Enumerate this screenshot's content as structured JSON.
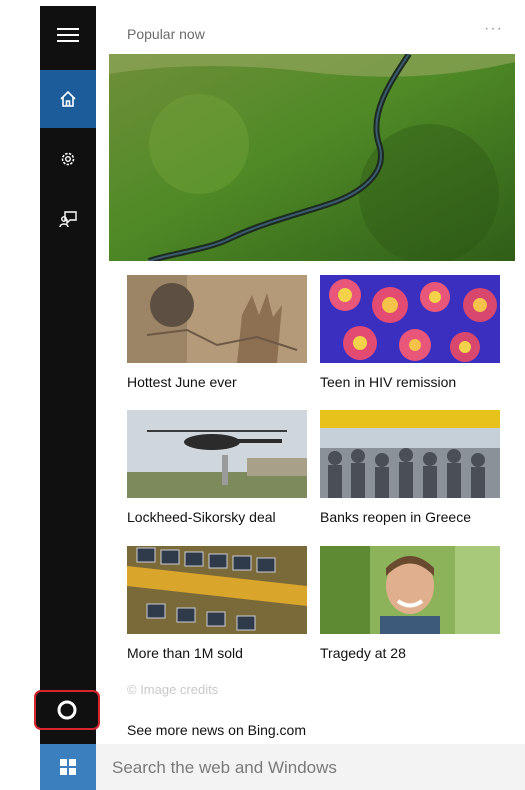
{
  "header": {
    "title": "Popular now",
    "more_label": "···"
  },
  "sidebar": {
    "items": [
      {
        "name": "menu",
        "icon": "hamburger-menu-icon"
      },
      {
        "name": "home",
        "icon": "home-icon"
      },
      {
        "name": "settings",
        "icon": "gear-icon"
      },
      {
        "name": "feedback",
        "icon": "feedback-icon"
      }
    ],
    "cortana_icon": "cortana-circle-icon"
  },
  "news": {
    "items": [
      {
        "caption": "Hottest June ever"
      },
      {
        "caption": "Teen in HIV remission"
      },
      {
        "caption": "Lockheed-Sikorsky deal"
      },
      {
        "caption": "Banks reopen in Greece"
      },
      {
        "caption": "More than 1M sold"
      },
      {
        "caption": "Tragedy at 28"
      }
    ]
  },
  "footer": {
    "credits": "© Image credits",
    "see_more": "See more news on Bing.com"
  },
  "taskbar": {
    "search_placeholder": "Search the web and Windows",
    "windows_icon": "windows-logo-icon"
  },
  "colors": {
    "sidebar_bg": "#101010",
    "active_accent": "#1d5c9a",
    "windows_button": "#3b7fbf",
    "highlight_border": "#d7262f"
  }
}
